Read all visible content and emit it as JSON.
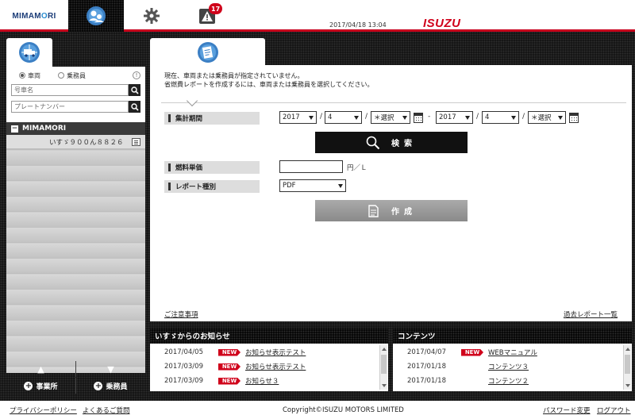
{
  "header": {
    "logo_text_pre": "MIMAM",
    "logo_text_o": "O",
    "logo_text_post": "RI",
    "alert_count": "17",
    "datetime": "2017/04/18 13:04",
    "brand_logo": "ISUZU",
    "brand_color": "#d0021b",
    "accent_line_color": "#c8001d"
  },
  "sidebar": {
    "radio_vehicle": "車両",
    "radio_driver": "乗務員",
    "info_icon_text": "!",
    "vehicle_name_placeholder": "号車名",
    "plate_number_placeholder": "プレートナンバー",
    "group_name": "MIMAMORI",
    "vehicles": [
      "いすゞ９００ん８８２６"
    ],
    "add_office_label": "事業所",
    "add_driver_label": "乗務員",
    "up_arrow": "▲",
    "down_arrow": "▼"
  },
  "main": {
    "notice_line1": "現在、車両または乗務員が指定されていません。",
    "notice_line2": "省燃費レポートを作成するには、車両または乗務員を選択してください。",
    "period_label": "集計期間",
    "start_year": "2017",
    "start_month": "4",
    "start_day": "＊選択",
    "end_year": "2017",
    "end_month": "4",
    "end_day": "＊選択",
    "slash": "/",
    "range_sep": "-",
    "search_button": "検索",
    "fuel_price_label": "燃料単価",
    "fuel_price_value": "",
    "fuel_unit": "円／Ｌ",
    "report_type_label": "レポート種別",
    "report_type_value": "PDF",
    "create_button": "作成",
    "notes_link": "ご注意事項",
    "past_reports_link": "過去レポート一覧"
  },
  "news": {
    "title": "いすゞからのお知らせ",
    "new_tag": "NEW",
    "items": [
      {
        "date": "2017/04/05",
        "title": "お知らせ表示テスト"
      },
      {
        "date": "2017/03/09",
        "title": "お知らせ表示テスト"
      },
      {
        "date": "2017/03/09",
        "title": "お知らせ３"
      }
    ]
  },
  "contents": {
    "title": "コンテンツ",
    "new_tag": "NEW",
    "items": [
      {
        "date": "2017/04/07",
        "title": "WEBマニュアル",
        "new": true
      },
      {
        "date": "2017/01/18",
        "title": "コンテンツ３",
        "new": false
      },
      {
        "date": "2017/01/18",
        "title": "コンテンツ２",
        "new": false
      }
    ]
  },
  "footer": {
    "privacy_link": "プライバシーポリシー",
    "faq_link": "よくあるご質問",
    "copyright": "Copyright©ISUZU MOTORS LIMITED",
    "password_link": "パスワード変更",
    "logout_link": "ログアウト"
  }
}
